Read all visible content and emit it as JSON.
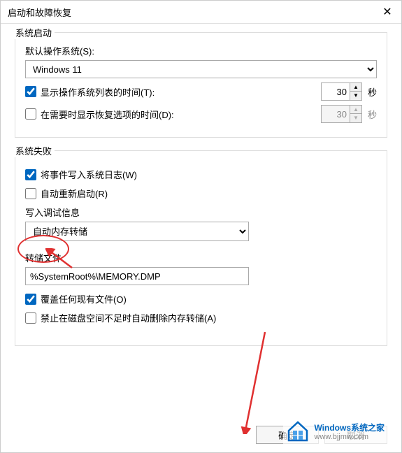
{
  "window": {
    "title": "启动和故障恢复"
  },
  "startup": {
    "group_label": "系统启动",
    "default_os_label": "默认操作系统(S):",
    "default_os_value": "Windows 11",
    "show_os_list_label": "显示操作系统列表的时间(T):",
    "show_os_list_checked": true,
    "show_os_list_seconds": "30",
    "show_recovery_label": "在需要时显示恢复选项的时间(D):",
    "show_recovery_checked": false,
    "show_recovery_seconds": "30",
    "seconds_unit": "秒"
  },
  "failure": {
    "group_label": "系统失败",
    "write_event_log_label": "将事件写入系统日志(W)",
    "write_event_log_checked": true,
    "auto_restart_label": "自动重新启动(R)",
    "auto_restart_checked": false,
    "debug_info_label": "写入调试信息",
    "dump_type_value": "自动内存转储",
    "dump_file_label": "转储文件:",
    "dump_file_value": "%SystemRoot%\\MEMORY.DMP",
    "overwrite_label": "覆盖任何现有文件(O)",
    "overwrite_checked": true,
    "no_delete_low_disk_label": "禁止在磁盘空间不足时自动删除内存转储(A)",
    "no_delete_low_disk_checked": false
  },
  "buttons": {
    "ok": "确定",
    "cancel": "取消"
  },
  "watermark": {
    "title": "Windows系统之家",
    "url": "www.bjjmw.com"
  }
}
